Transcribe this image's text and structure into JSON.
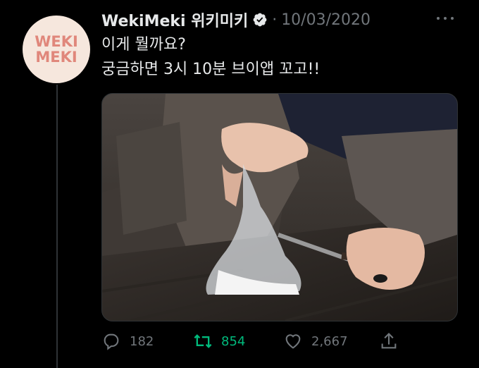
{
  "account": {
    "display_name": "WekiMeki 위키미키",
    "separator": "·",
    "date": "10/03/2020",
    "avatar_text_line1": "WEKI",
    "avatar_text_line2": "MEKI"
  },
  "tweet": {
    "line1": "이게 뭘까요?",
    "line2": "궁금하면 3시 10분 브이앱 꼬고!!"
  },
  "media": {
    "icon": "photo-icon"
  },
  "actions": {
    "replies": "182",
    "retweets": "854",
    "likes": "2,667"
  },
  "colors": {
    "background": "#000000",
    "text": "#e7e9ea",
    "muted": "#71767b",
    "retweet_active": "#00ba7c",
    "avatar_bg": "#f6e7dd",
    "avatar_logo": "#e0877b"
  }
}
